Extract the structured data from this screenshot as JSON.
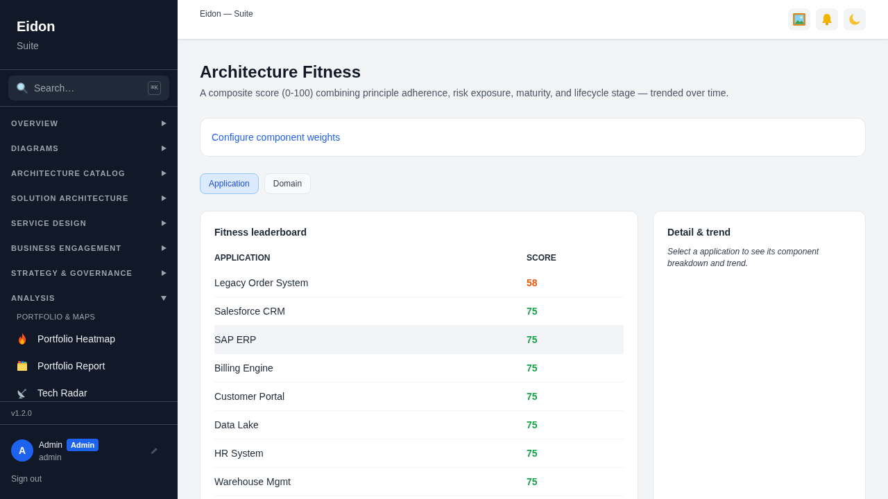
{
  "sidebar": {
    "brand": {
      "name": "Eidon",
      "subtitle": "Suite"
    },
    "search": {
      "placeholder": "Search…",
      "shortcut": "⌘K"
    },
    "sections": [
      {
        "label": "OVERVIEW",
        "expanded": false
      },
      {
        "label": "DIAGRAMS",
        "expanded": false
      },
      {
        "label": "ARCHITECTURE CATALOG",
        "expanded": false
      },
      {
        "label": "SOLUTION ARCHITECTURE",
        "expanded": false
      },
      {
        "label": "SERVICE DESIGN",
        "expanded": false
      },
      {
        "label": "BUSINESS ENGAGEMENT",
        "expanded": false
      },
      {
        "label": "STRATEGY & GOVERNANCE",
        "expanded": false
      },
      {
        "label": "ANALYSIS",
        "expanded": true,
        "groups": [
          {
            "label": "PORTFOLIO & MAPS",
            "items": [
              {
                "label": "Portfolio Heatmap"
              },
              {
                "label": "Portfolio Report"
              },
              {
                "label": "Tech Radar"
              }
            ]
          }
        ]
      }
    ],
    "version": "v1.2.0",
    "user": {
      "initial": "A",
      "name": "Admin",
      "role": "Admin",
      "username": "admin"
    },
    "sign_out": "Sign out"
  },
  "topbar": {
    "breadcrumb": "Eidon — Suite"
  },
  "page": {
    "title": "Architecture Fitness",
    "subtitle": "A composite score (0-100) combining principle adherence, risk exposure, maturity, and lifecycle stage — trended over time.",
    "config_link": "Configure component weights",
    "tabs": [
      {
        "label": "Application",
        "selected": true
      },
      {
        "label": "Domain",
        "selected": false
      }
    ]
  },
  "leaderboard": {
    "title": "Fitness leaderboard",
    "columns": [
      "APPLICATION",
      "SCORE"
    ],
    "rows": [
      {
        "application": "Legacy Order System",
        "score": "58",
        "color": "#ea580c",
        "hovered": false
      },
      {
        "application": "Salesforce CRM",
        "score": "75",
        "color": "#16a34a",
        "hovered": false
      },
      {
        "application": "SAP ERP",
        "score": "75",
        "color": "#16a34a",
        "hovered": true
      },
      {
        "application": "Billing Engine",
        "score": "75",
        "color": "#16a34a",
        "hovered": false
      },
      {
        "application": "Customer Portal",
        "score": "75",
        "color": "#16a34a",
        "hovered": false
      },
      {
        "application": "Data Lake",
        "score": "75",
        "color": "#16a34a",
        "hovered": false
      },
      {
        "application": "HR System",
        "score": "75",
        "color": "#16a34a",
        "hovered": false
      },
      {
        "application": "Warehouse Mgmt",
        "score": "75",
        "color": "#16a34a",
        "hovered": false
      }
    ]
  },
  "detail": {
    "title": "Detail & trend",
    "hint": "Select a application to see its component breakdown and trend."
  }
}
